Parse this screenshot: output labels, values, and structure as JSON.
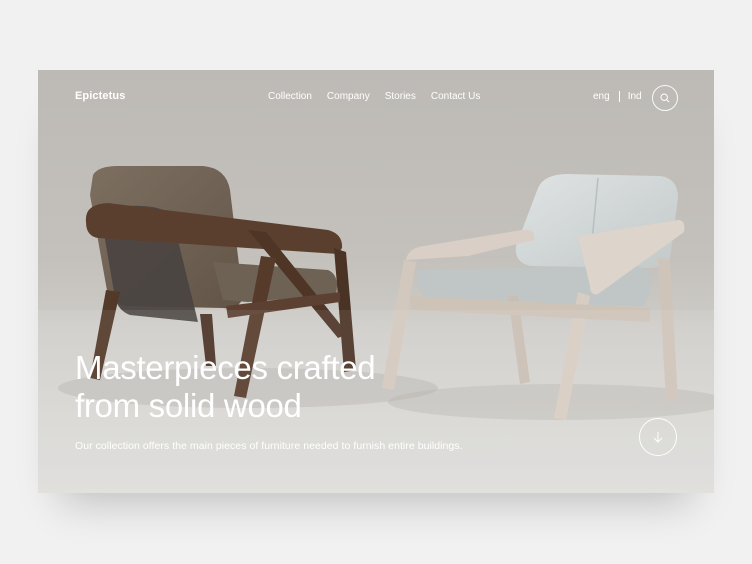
{
  "brand": {
    "logo_text": "Epictetus"
  },
  "nav": {
    "items": [
      {
        "label": "Collection"
      },
      {
        "label": "Company"
      },
      {
        "label": "Stories"
      },
      {
        "label": "Contact Us"
      }
    ]
  },
  "language": {
    "primary": "eng",
    "secondary": "Ind"
  },
  "search": {
    "icon": "search-icon"
  },
  "hero": {
    "title_line1": "Masterpieces crafted",
    "title_line2": "from solid wood",
    "subtitle": "Our collection offers the main pieces of furniture needed to furnish entire buildings.",
    "scroll_icon": "arrow-down-icon",
    "image": "two-wooden-armchairs"
  },
  "colors": {
    "page_bg": "#f1f1f1",
    "hero_bg": "#c4c1bc",
    "text": "#ffffff"
  }
}
